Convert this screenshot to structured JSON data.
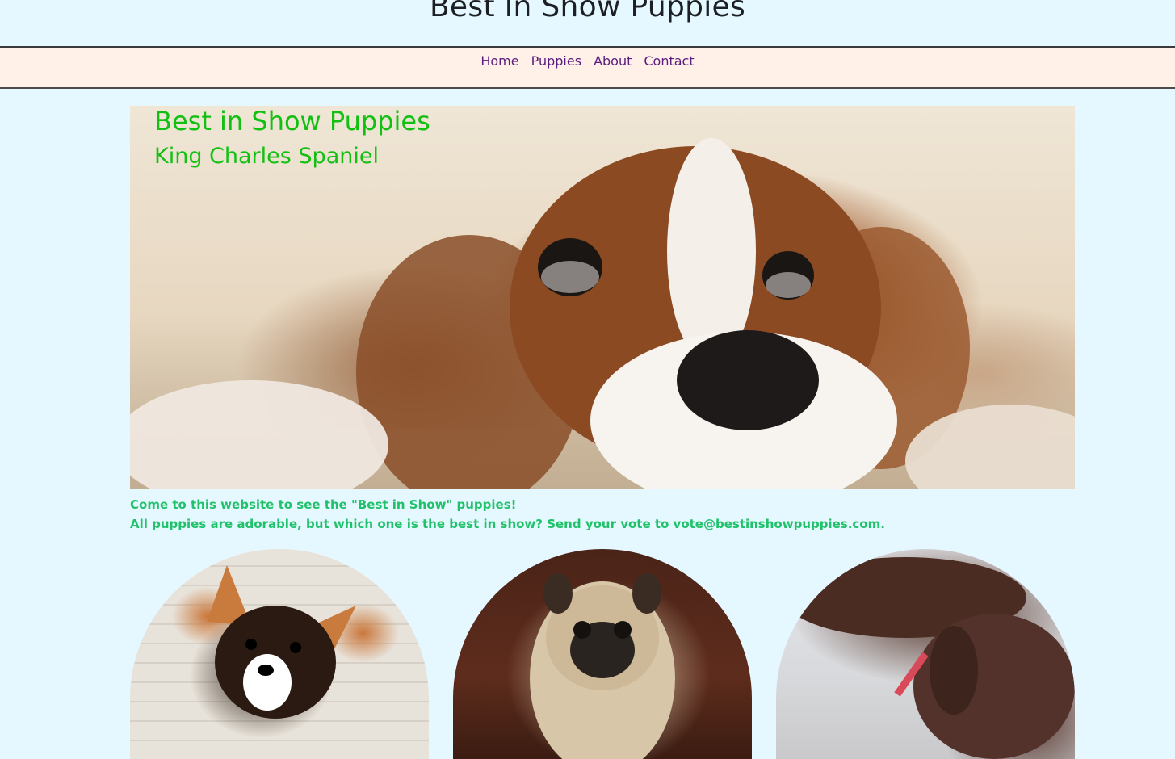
{
  "header": {
    "title": "Best In Show Puppies"
  },
  "nav": {
    "items": [
      {
        "label": "Home"
      },
      {
        "label": "Puppies"
      },
      {
        "label": "About"
      },
      {
        "label": "Contact"
      }
    ]
  },
  "hero": {
    "title": "Best in Show Puppies",
    "subtitle": "King Charles Spaniel"
  },
  "intro": {
    "line1": "Come to this website to see the \"Best in Show\" puppies!",
    "line2": "All puppies are adorable, but which one is the best in show? Send your vote to vote@bestinshowpuppies.com."
  },
  "colors": {
    "page_background": "#e6f8ff",
    "nav_background": "#fff0e8",
    "nav_link": "#5b1d80",
    "hero_text": "#12c012",
    "intro_text": "#1fc26a"
  }
}
